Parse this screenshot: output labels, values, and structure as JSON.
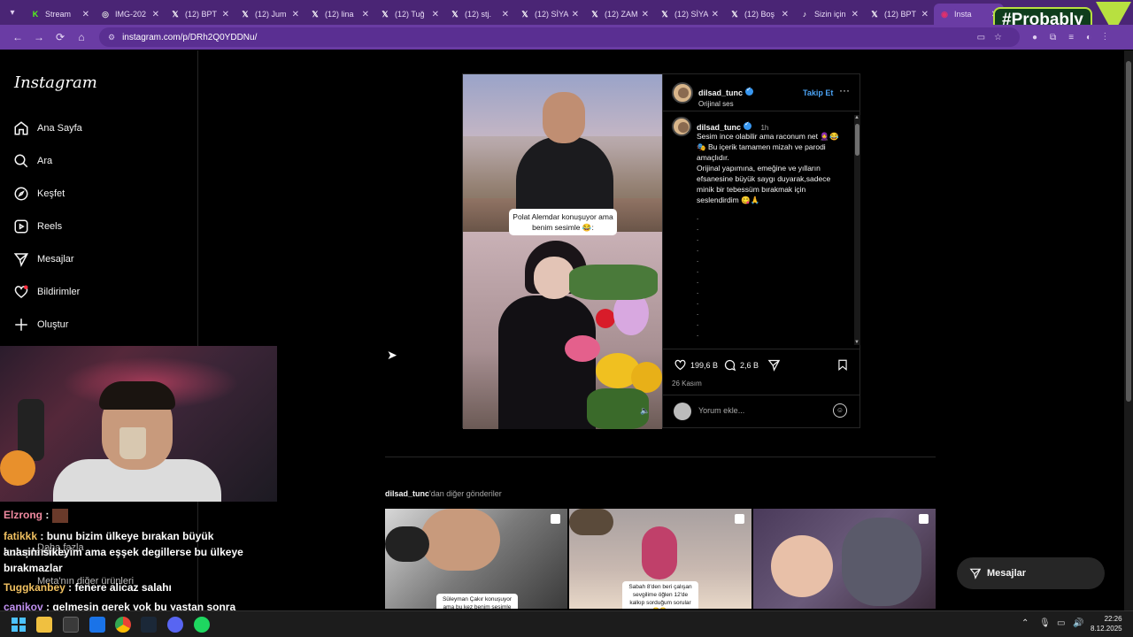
{
  "browser": {
    "tabs": [
      {
        "icon": "K",
        "label": "Stream",
        "color": "#53fc18",
        "active": false
      },
      {
        "icon": "◎",
        "label": "IMG-202",
        "color": "#ddd",
        "active": false
      },
      {
        "icon": "𝕏",
        "label": "(12) BPT",
        "color": "#fff",
        "active": false
      },
      {
        "icon": "𝕏",
        "label": "(12) Jum",
        "color": "#fff",
        "active": false
      },
      {
        "icon": "𝕏",
        "label": "(12) lina",
        "color": "#fff",
        "active": false
      },
      {
        "icon": "𝕏",
        "label": "(12) Tuğ",
        "color": "#fff",
        "active": false
      },
      {
        "icon": "𝕏",
        "label": "(12) stj.",
        "color": "#fff",
        "active": false
      },
      {
        "icon": "𝕏",
        "label": "(12) SİYA",
        "color": "#fff",
        "active": false
      },
      {
        "icon": "𝕏",
        "label": "(12) ZAM",
        "color": "#fff",
        "active": false
      },
      {
        "icon": "𝕏",
        "label": "(12) SİYA",
        "color": "#fff",
        "active": false
      },
      {
        "icon": "𝕏",
        "label": "(12) Boş",
        "color": "#fff",
        "active": false
      },
      {
        "icon": "♪",
        "label": "Sizin için",
        "color": "#fff",
        "active": false
      },
      {
        "icon": "𝕏",
        "label": "(12) BPT",
        "color": "#fff",
        "active": false
      },
      {
        "icon": "◉",
        "label": "Insta",
        "color": "#e1306c",
        "active": true
      }
    ],
    "url": "instagram.com/p/DRh2Q0YDDNu/"
  },
  "overlay_badge": "#Probably",
  "sidebar": {
    "logo": "Instagram",
    "items": [
      {
        "label": "Ana Sayfa",
        "icon": "home-icon"
      },
      {
        "label": "Ara",
        "icon": "search-icon"
      },
      {
        "label": "Keşfet",
        "icon": "explore-icon"
      },
      {
        "label": "Reels",
        "icon": "reels-icon"
      },
      {
        "label": "Mesajlar",
        "icon": "messages-icon"
      },
      {
        "label": "Bildirimler",
        "icon": "heart-icon"
      },
      {
        "label": "Oluştur",
        "icon": "plus-icon"
      }
    ],
    "more_label": "Daha fazla",
    "meta_label": "Meta'nın diğer ürünleri"
  },
  "chat": [
    {
      "user": "Elzrong",
      "text": ""
    },
    {
      "user": "fatikkk",
      "text": "bunu bizim ülkeye bırakan büyük kuluplerinde"
    },
    {
      "user": "",
      "text": "anasini sikeyim ama eşşek degillerse bu ülkeye"
    },
    {
      "user": "",
      "text": "bırakmazlar"
    },
    {
      "user": "Tuggkanbey",
      "text": "fenere alicaz salahı"
    },
    {
      "user": "canikov",
      "text": "gelmesin gerek yok bu yaştan sonra"
    }
  ],
  "post": {
    "video_caption": "Polat Alemdar konuşuyor ama benim sesimle 😂:",
    "username": "dilsad_tunc",
    "audio": "Orijinal ses",
    "follow": "Takip Et",
    "time": "1h",
    "caption_lines": [
      "Sesim ince olabilir ama raconum net 🧕😂",
      "🎭 Bu içerik tamamen mizah ve parodi amaçlıdır.",
      "Orijinal yapımına, emeğine ve yılların efsanesine büyük saygı duyarak,sadece minik bir tebessüm bırakmak için seslendirdim 😋🙏"
    ],
    "likes": "199,6 B",
    "comments": "2,6 B",
    "date": "26 Kasım",
    "comment_placeholder": "Yorum ekle..."
  },
  "more_posts": {
    "title_user": "dilsad_tunc",
    "title_suffix": "'dan diğer gönderiler",
    "items": [
      {
        "caption": "Süleyman Çakır konuşuyor ama bu kez benim sesimle 😂"
      },
      {
        "caption": "Sabah 8'den beri çalışan sevgilime öğlen 12'de kalkıp sorduğum sorular 😂😂:"
      },
      {
        "caption": ""
      }
    ]
  },
  "messages_button": "Mesajlar",
  "taskbar": {
    "time": "22:26",
    "date": "8.12.2025"
  },
  "colors": {
    "browser_tabs": "#4a2575",
    "browser_bar": "#6a3ca4",
    "instagram_bg": "#000000",
    "link_blue": "#4ba3f5"
  }
}
